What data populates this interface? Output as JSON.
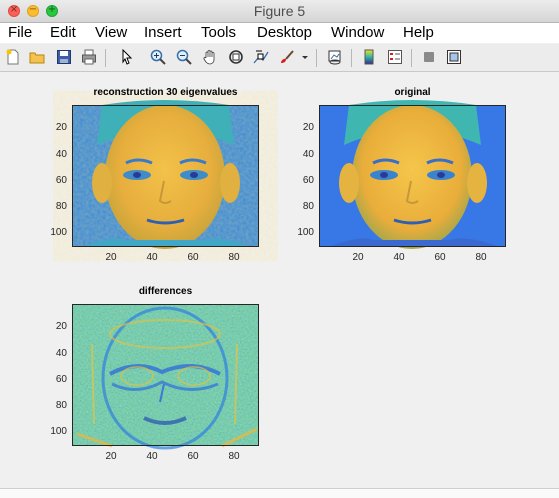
{
  "window": {
    "title": "Figure 5"
  },
  "menu": [
    "File",
    "Edit",
    "View",
    "Insert",
    "Tools",
    "Desktop",
    "Window",
    "Help"
  ],
  "toolbar": {
    "icons": [
      "new-file-icon",
      "open-folder-icon",
      "save-icon",
      "print-icon",
      "pointer-icon",
      "zoom-in-icon",
      "zoom-out-icon",
      "pan-hand-icon",
      "rotate-3d-icon",
      "data-cursor-icon",
      "brush-icon",
      "dropdown-arrow-icon",
      "link-plot-icon",
      "colorbar-icon",
      "legend-icon",
      "hide-plot-tools-icon",
      "show-plot-tools-icon"
    ]
  },
  "plots": [
    {
      "title": "reconstruction 30 eigenvalues",
      "y_ticks": [
        "20",
        "40",
        "60",
        "80",
        "100"
      ],
      "x_ticks": [
        "20",
        "40",
        "60",
        "80"
      ],
      "image": "reconstructed face, parula colormap"
    },
    {
      "title": "original",
      "y_ticks": [
        "20",
        "40",
        "60",
        "80",
        "100"
      ],
      "x_ticks": [
        "20",
        "40",
        "60",
        "80"
      ],
      "image": "original face, parula colormap"
    },
    {
      "title": "differences",
      "y_ticks": [
        "20",
        "40",
        "60",
        "80",
        "100"
      ],
      "x_ticks": [
        "20",
        "40",
        "60",
        "80"
      ],
      "image": "difference image, parula colormap"
    }
  ],
  "colors": {
    "face_yellow": "#f2bd45",
    "face_orange": "#e6a93b",
    "bg_blue": "#3f80e0",
    "bg_cyan": "#3fb7b0",
    "dark_blue": "#2a3b95",
    "diff_base": "#3dbfa6"
  }
}
